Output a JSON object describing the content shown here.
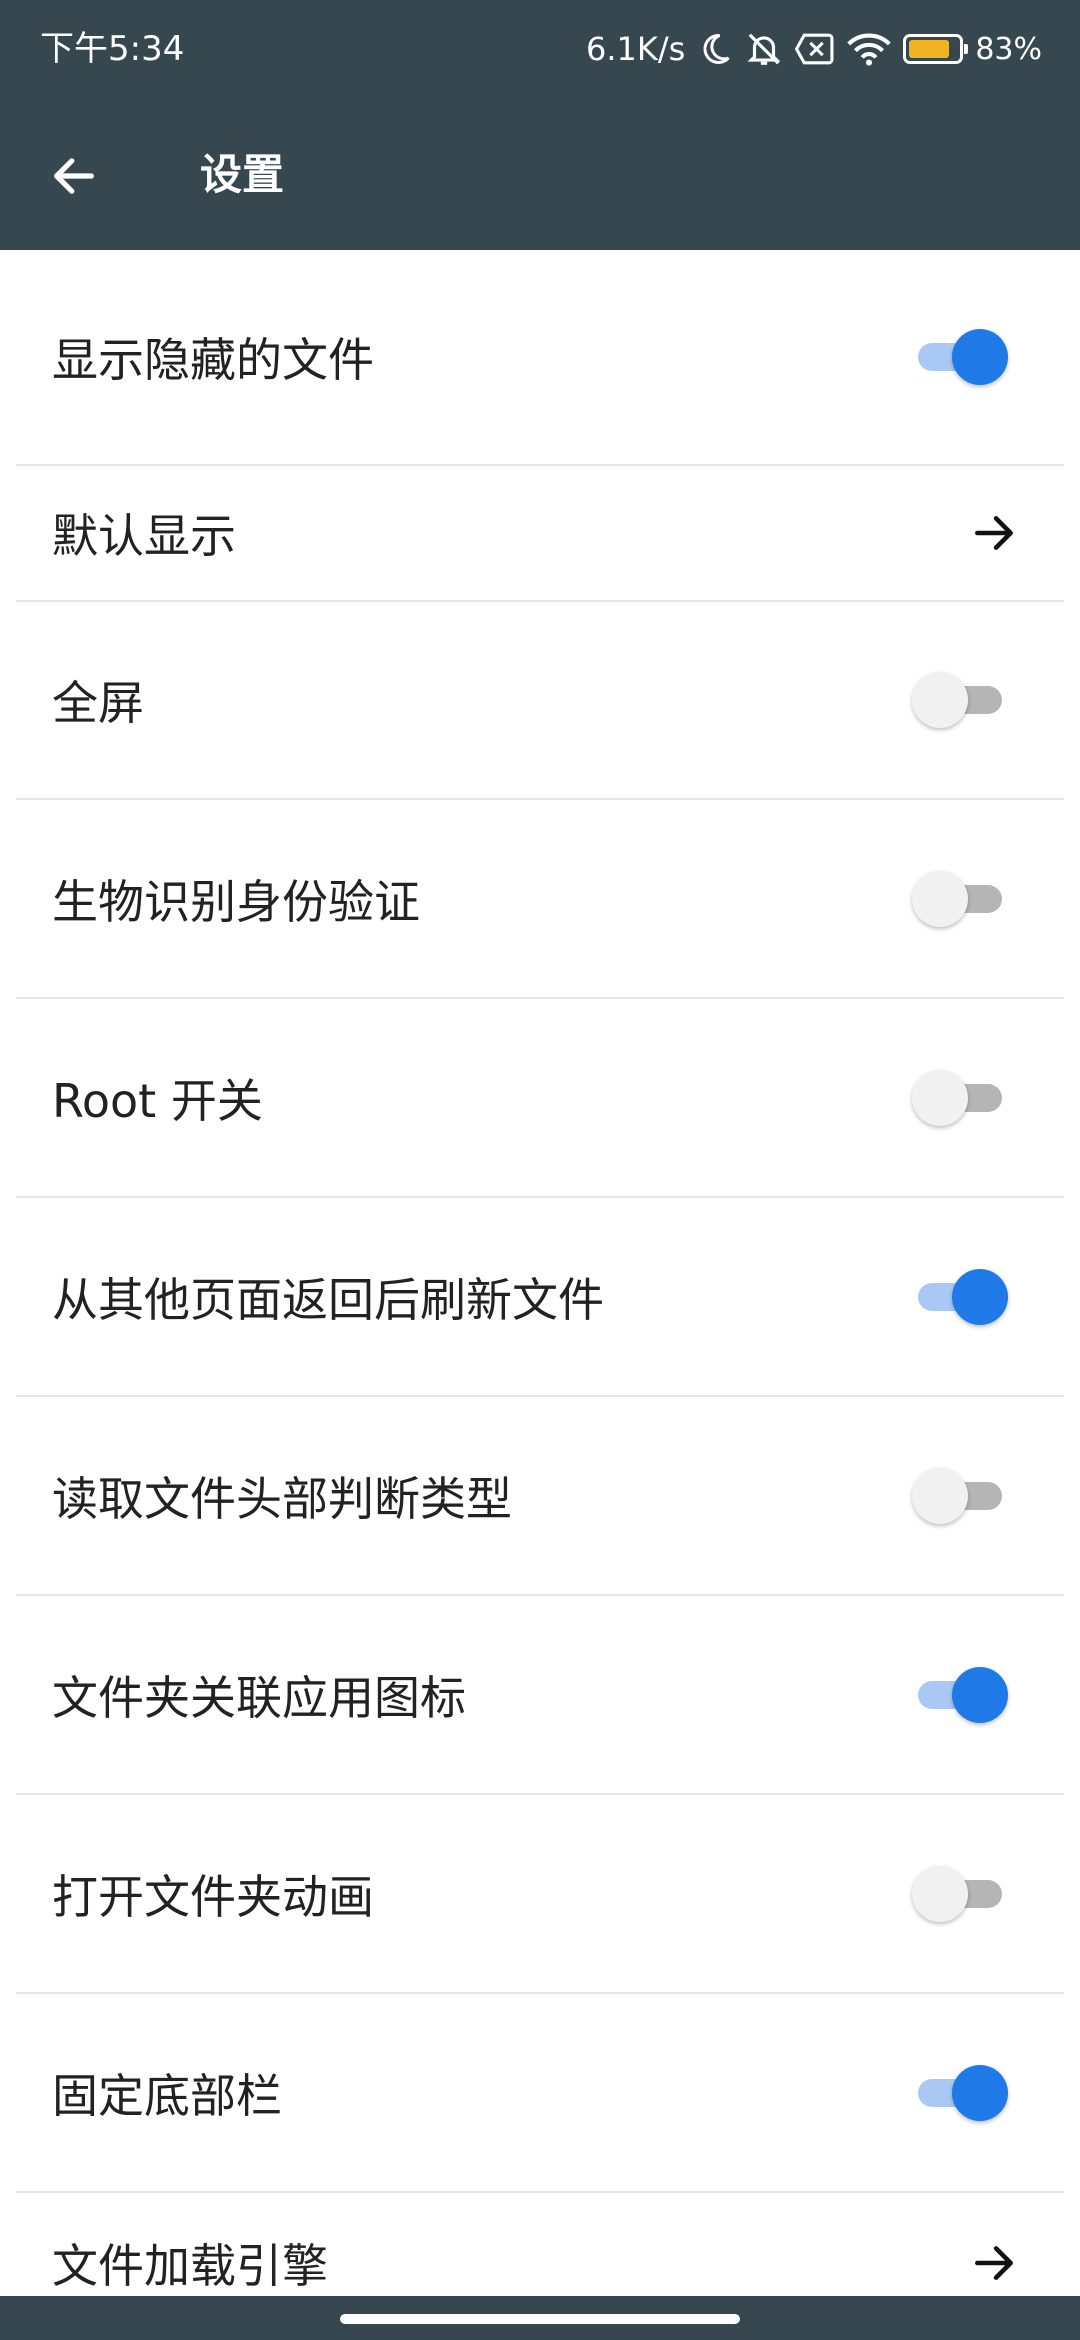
{
  "status_bar": {
    "time": "下午5:34",
    "network_speed": "6.1K/s",
    "battery_percent": "83%",
    "battery_level": 0.83,
    "icons": [
      "moon-icon",
      "bell-off-icon",
      "sim-off-icon",
      "wifi-icon",
      "battery-icon"
    ]
  },
  "app_bar": {
    "title": "设置",
    "back_icon": "arrow-left-icon"
  },
  "colors": {
    "toolbar": "#37474f",
    "switch_on_thumb": "#1f7ae7",
    "switch_on_track": "#a9c9f4",
    "switch_off_thumb": "#f1f1f1",
    "switch_off_track": "#b5b5b5",
    "battery": "#f0b323"
  },
  "settings": {
    "items": [
      {
        "label": "显示隐藏的文件",
        "control": "switch",
        "on": true
      },
      {
        "label": "默认显示",
        "control": "arrow",
        "icon": "arrow-right-icon"
      },
      {
        "label": "全屏",
        "control": "switch",
        "on": false
      },
      {
        "label": "生物识别身份验证",
        "control": "switch",
        "on": false
      },
      {
        "label": "Root 开关",
        "control": "switch",
        "on": false
      },
      {
        "label": "从其他页面返回后刷新文件",
        "control": "switch",
        "on": true
      },
      {
        "label": "读取文件头部判断类型",
        "control": "switch",
        "on": false
      },
      {
        "label": "文件夹关联应用图标",
        "control": "switch",
        "on": true
      },
      {
        "label": "打开文件夹动画",
        "control": "switch",
        "on": false
      },
      {
        "label": "固定底部栏",
        "control": "switch",
        "on": true
      },
      {
        "label": "文件加载引擎",
        "control": "arrow",
        "icon": "arrow-right-icon"
      }
    ]
  }
}
